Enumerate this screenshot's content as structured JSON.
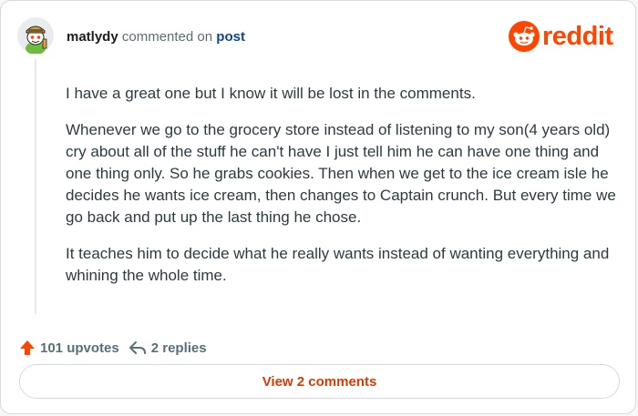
{
  "comment": {
    "username": "matlydy",
    "action_text": "commented on",
    "post_link_text": "post",
    "avatar_icon": "snoo-avatar-icon",
    "paragraphs": [
      "I have a great one but I know it will be lost in the comments.",
      "Whenever we go to the grocery store instead of listening to my son(4 years old) cry about all of the stuff he can't have I just tell him he can have one thing and one thing only. So he grabs cookies. Then when we get to the ice cream isle he decides he wants ice cream, then changes to Captain crunch. But every time we go back and put up the last thing he chose.",
      "It teaches him to decide what he really wants instead of wanting everything and whining the whole time."
    ]
  },
  "brand": {
    "logo_text": "reddit",
    "logo_icon": "reddit-alien-icon",
    "color": "#ff4500"
  },
  "footer": {
    "upvotes_label": "101 upvotes",
    "replies_label": "2 replies",
    "upvote_icon": "upvote-arrow-icon",
    "reply_icon": "reply-arrow-icon"
  },
  "view_button": {
    "label": "View 2 comments"
  }
}
